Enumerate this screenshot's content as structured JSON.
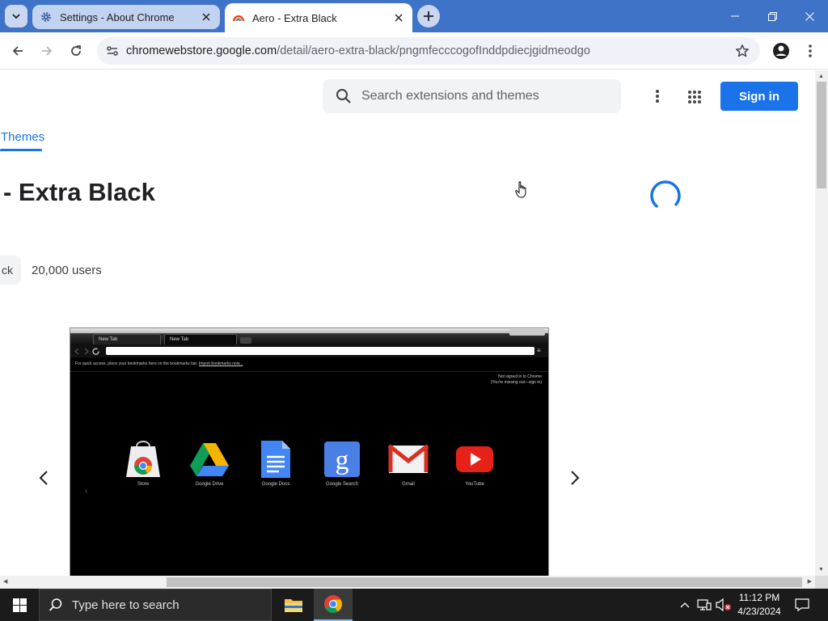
{
  "tabs": [
    {
      "title": "Settings - About Chrome",
      "icon": "gear-icon",
      "active": false
    },
    {
      "title": "Aero - Extra Black",
      "icon": "rainbow-theme-icon",
      "active": true
    }
  ],
  "toolbar": {
    "url_host": "chromewebstore.google.com",
    "url_path": "/detail/aero-extra-black/pngmfecccogofInddpdiecjgidmeodgo"
  },
  "page": {
    "search_placeholder": "Search extensions and themes",
    "sign_in_label": "Sign in",
    "nav_tab": "Themes",
    "item_title": "- Extra Black",
    "chip_label": "ck",
    "users": "20,000 users"
  },
  "preview": {
    "tabs": [
      "New Tab",
      "New Tab"
    ],
    "bookmark_text": "For quick access, place your bookmarks here on the bookmarks bar.",
    "bookmark_link": "Import bookmarks now...",
    "signed_line1": "Not signed in to Chrome",
    "signed_line2": "(You're missing out—sign in)",
    "apps": [
      {
        "label": "Store",
        "icon": "web-store-icon"
      },
      {
        "label": "Google Drive",
        "icon": "google-drive-icon"
      },
      {
        "label": "Google Docs",
        "icon": "google-docs-icon"
      },
      {
        "label": "Google Search",
        "icon": "google-search-icon"
      },
      {
        "label": "Gmail",
        "icon": "gmail-icon"
      },
      {
        "label": "YouTube",
        "icon": "youtube-icon"
      }
    ]
  },
  "taskbar": {
    "search_placeholder": "Type here to search",
    "time": "11:12 PM",
    "date": "4/23/2024"
  },
  "colors": {
    "tabstrip": "#3e73c7",
    "accent": "#1a73e8",
    "taskbar": "#1b1b1b"
  }
}
